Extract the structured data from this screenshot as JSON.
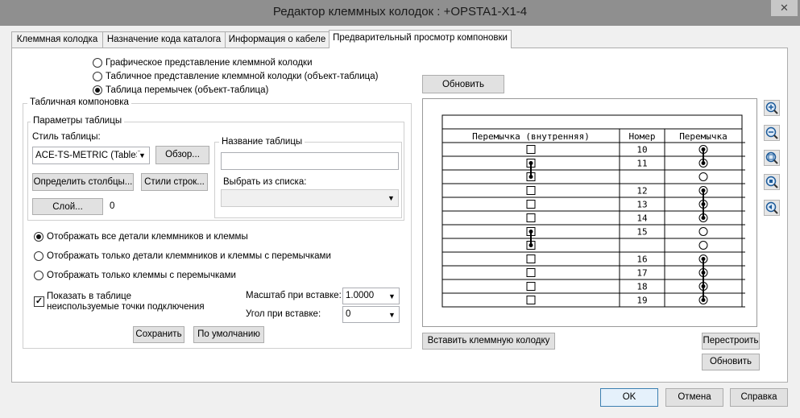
{
  "window": {
    "title": "Редактор клеммных колодок : +OPSTA1-X1-4",
    "close_glyph": "✕"
  },
  "tabs": [
    {
      "label": "Клеммная колодка"
    },
    {
      "label": "Назначение кода каталога"
    },
    {
      "label": "Информация о кабеле"
    },
    {
      "label": "Предварительный просмотр компоновки"
    }
  ],
  "display_mode": [
    {
      "label": "Графическое представление клеммной колодки",
      "selected": false
    },
    {
      "label": "Табличное представление клеммной колодки (объект-таблица)",
      "selected": false
    },
    {
      "label": "Таблица перемычек (объект-таблица)",
      "selected": true
    }
  ],
  "layout": {
    "group_label": "Табличная компоновка",
    "params_label": "Параметры таблицы",
    "style_label": "Стиль таблицы:",
    "style_value": "ACE-TS-METRIC (TableSt",
    "browse_btn": "Обзор...",
    "define_cols_btn": "Определить столбцы...",
    "row_styles_btn": "Стили строк...",
    "layer_btn": "Слой...",
    "layer_value": "0",
    "table_name_label": "Название таблицы",
    "table_name_value": "",
    "pick_list_label": "Выбрать из списка:",
    "pick_list_value": ""
  },
  "detail_options": [
    {
      "label": "Отображать все детали клеммников и клеммы",
      "selected": true
    },
    {
      "label": "Отображать только детали клеммников и клеммы с перемычками",
      "selected": false
    },
    {
      "label": "Отображать только клеммы с перемычками",
      "selected": false
    }
  ],
  "unused_points": {
    "line1": "Показать в таблице",
    "line2": "неиспользуемые точки подключения",
    "checked": true,
    "check_glyph": "✓"
  },
  "scale": {
    "label": "Масштаб при вставке:",
    "value": "1.0000"
  },
  "angle": {
    "label": "Угол при вставке:",
    "value": "0"
  },
  "save_btn": "Сохранить",
  "default_btn": "По умолчанию",
  "refresh_top_btn": "Обновить",
  "insert_btn": "Вставить клеммную колодку",
  "rebuild_btn": "Перестроить",
  "refresh_bottom_btn": "Обновить",
  "footer": {
    "ok": "OK",
    "cancel": "Отмена",
    "help": "Справка"
  },
  "preview_table": {
    "headers": [
      "Перемычка (внутренняя)",
      "Номер",
      "Перемычка"
    ],
    "rows": [
      {
        "num": "10"
      },
      {
        "num": "11"
      },
      {
        "num": ""
      },
      {
        "num": "12"
      },
      {
        "num": "13"
      },
      {
        "num": "14"
      },
      {
        "num": "15"
      },
      {
        "num": ""
      },
      {
        "num": "16"
      },
      {
        "num": "17"
      },
      {
        "num": "18"
      },
      {
        "num": "19"
      }
    ]
  },
  "zoom_icons": [
    "zoom-in-icon",
    "zoom-out-icon",
    "zoom-window-icon",
    "zoom-extents-icon",
    "zoom-previous-icon"
  ]
}
